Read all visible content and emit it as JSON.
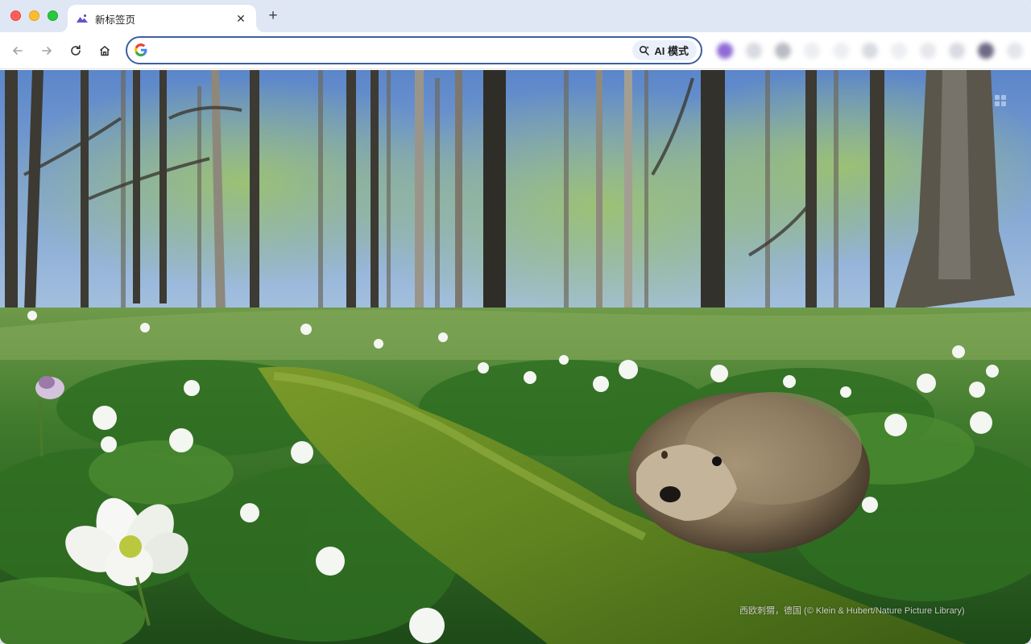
{
  "window": {
    "tab": {
      "title": "新标签页",
      "favicon": "mountain-photo-icon",
      "close_symbol": "✕"
    },
    "new_tab_symbol": "+"
  },
  "toolbar": {
    "back_icon": "back-arrow-icon",
    "forward_icon": "forward-arrow-icon",
    "reload_icon": "reload-icon",
    "home_icon": "home-icon",
    "omnibox": {
      "value": "",
      "placeholder": "",
      "ai_mode_label": "AI 模式"
    },
    "extensions_blurred": true
  },
  "wallpaper": {
    "subject": "hedgehog on mossy log in forest",
    "attribution": "西欧刺猬，德国 (© Klein & Hubert/Nature Picture Library)"
  },
  "colors": {
    "tabstrip": "#dfe6f4",
    "omnibox_border": "#3e5f9e",
    "ai_chip": "#eaf0fb"
  }
}
